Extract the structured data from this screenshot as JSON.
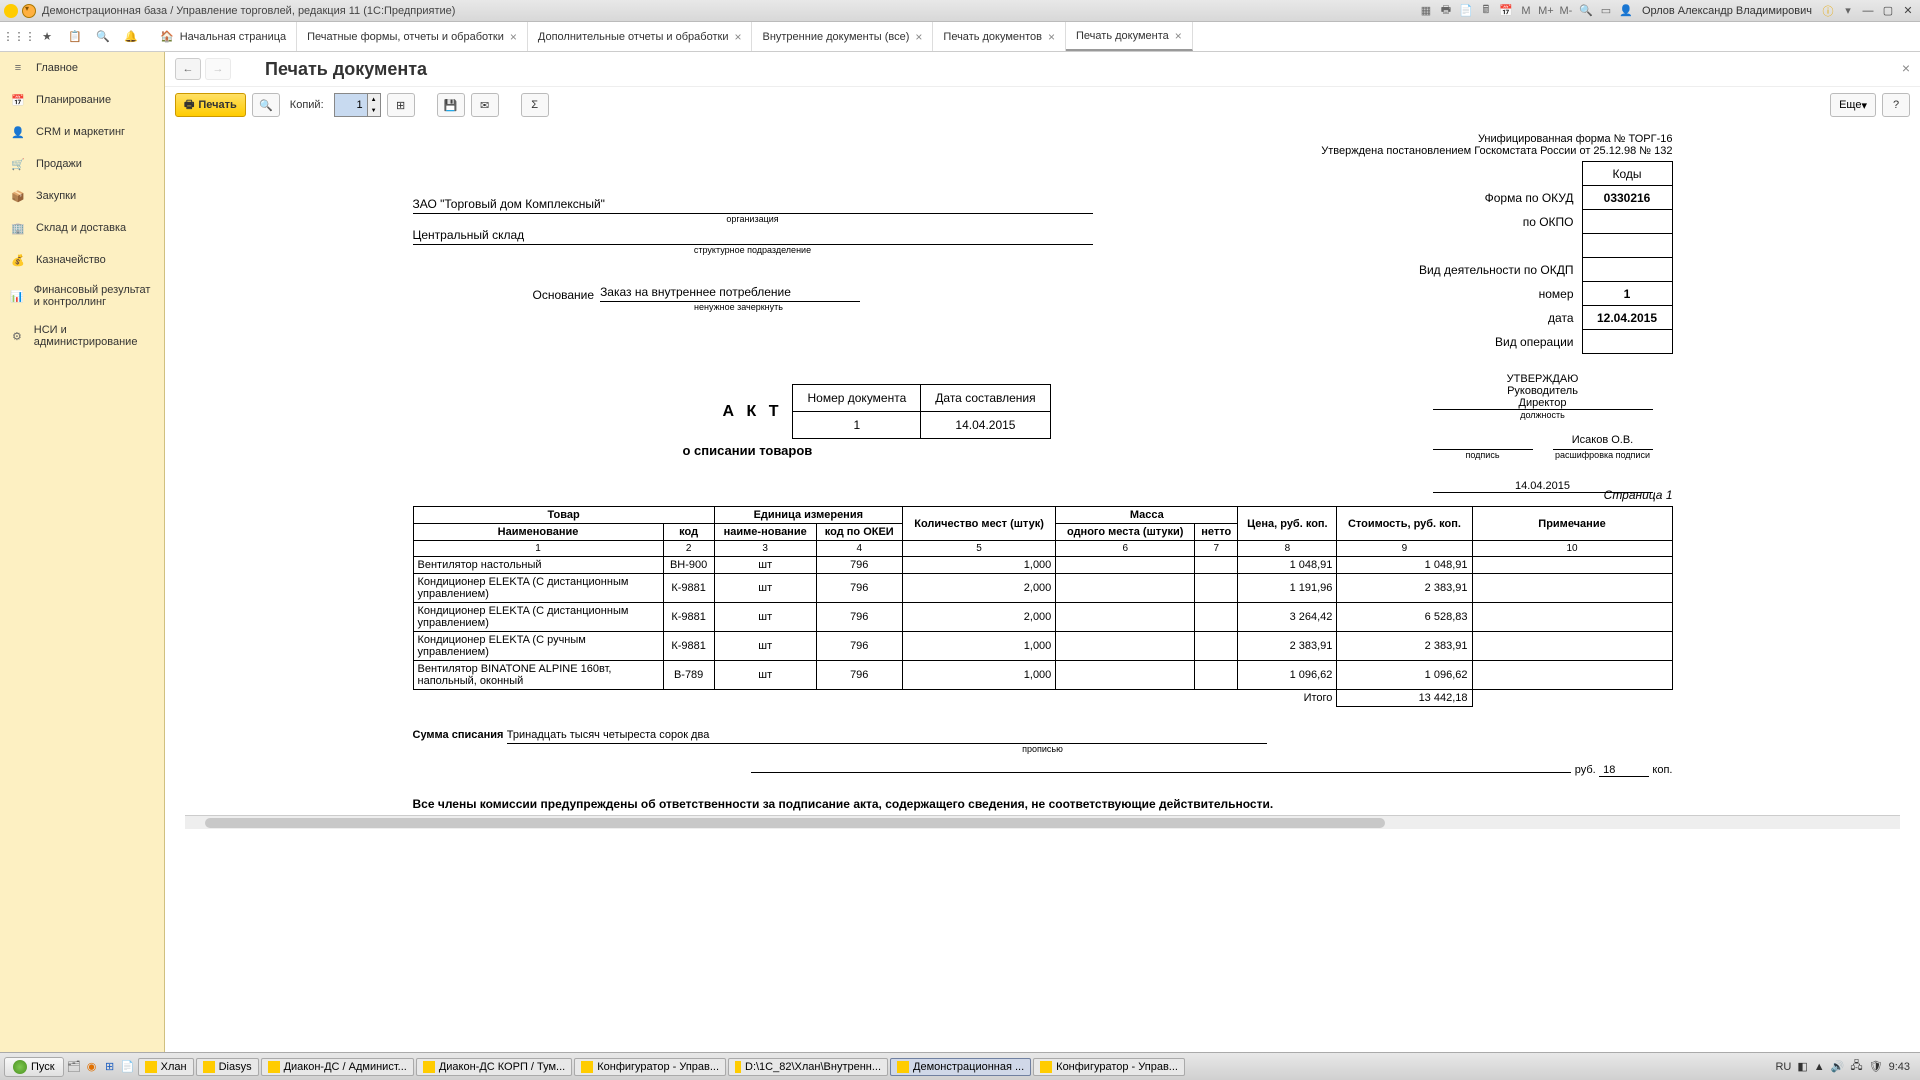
{
  "titlebar": {
    "title": "Демонстрационная база / Управление торговлей, редакция 11  (1С:Предприятие)",
    "user": "Орлов Александр Владимирович"
  },
  "tabs": [
    {
      "label": "Начальная страница",
      "closable": false,
      "home": true
    },
    {
      "label": "Печатные формы, отчеты и обработки",
      "closable": true
    },
    {
      "label": "Дополнительные отчеты и обработки",
      "closable": true
    },
    {
      "label": "Внутренние документы (все)",
      "closable": true
    },
    {
      "label": "Печать документов",
      "closable": true
    },
    {
      "label": "Печать документа",
      "closable": true,
      "active": true
    }
  ],
  "sidebar": [
    {
      "icon": "≡",
      "label": "Главное"
    },
    {
      "icon": "📅",
      "label": "Планирование"
    },
    {
      "icon": "👤",
      "label": "CRM и маркетинг"
    },
    {
      "icon": "🛒",
      "label": "Продажи"
    },
    {
      "icon": "📦",
      "label": "Закупки"
    },
    {
      "icon": "🏢",
      "label": "Склад и доставка"
    },
    {
      "icon": "💰",
      "label": "Казначейство"
    },
    {
      "icon": "📊",
      "label": "Финансовый результат и контроллинг"
    },
    {
      "icon": "⚙",
      "label": "НСИ и администрирование"
    }
  ],
  "content": {
    "title": "Печать документа",
    "print_btn": "Печать",
    "copies_label": "Копий:",
    "copies_value": "1",
    "more_btn": "Еще"
  },
  "doc": {
    "form_header1": "Унифицированная форма № ТОРГ-16",
    "form_header2": "Утверждена постановлением Госкомстата России от 25.12.98 № 132",
    "codes_header": "Коды",
    "okud_label": "Форма по ОКУД",
    "okud_value": "0330216",
    "okpo_label": "по ОКПО",
    "okdp_label": "Вид деятельности по ОКДП",
    "num_label": "номер",
    "num_value": "1",
    "date_label": "дата",
    "date_value": "12.04.2015",
    "oper_label": "Вид операции",
    "org": "ЗАО \"Торговый дом Комплексный\"",
    "org_sub": "организация",
    "dept": "Центральный склад",
    "dept_sub": "структурное подразделение",
    "basis_label": "Основание",
    "basis_value": "Заказ на внутреннее потребление",
    "basis_sub": "ненужное зачеркнуть",
    "doc_num_h": "Номер документа",
    "doc_date_h": "Дата составления",
    "doc_num": "1",
    "doc_date": "14.04.2015",
    "act": "А К Т",
    "act_sub": "о списании товаров",
    "approve": "УТВЕРЖДАЮ",
    "approve_role": "Руководитель",
    "approve_pos": "Директор",
    "approve_pos_sub": "должность",
    "approve_sign_sub": "подпись",
    "approve_name": "Исаков О.В.",
    "approve_name_sub": "расшифровка подписи",
    "approve_date": "14.04.2015",
    "page": "Страница 1",
    "th": {
      "tovar": "Товар",
      "unit": "Единица измерения",
      "qty": "Количество мест (штук)",
      "mass": "Масса",
      "price": "Цена, руб. коп.",
      "cost": "Стоимость, руб. коп.",
      "note": "Примечание",
      "name": "Наименование",
      "code": "код",
      "uname": "наиме-нование",
      "okei": "код по ОКЕИ",
      "one": "одного места (штуки)",
      "netto": "нетто"
    },
    "nums": [
      "1",
      "2",
      "3",
      "4",
      "5",
      "6",
      "7",
      "8",
      "9",
      "10"
    ],
    "rows": [
      {
        "name": "Вентилятор настольный",
        "code": "ВН-900",
        "unit": "шт",
        "okei": "796",
        "qty": "1,000",
        "price": "1 048,91",
        "cost": "1 048,91"
      },
      {
        "name": "Кондиционер ELEKTA (С дистанционным управлением)",
        "code": "К-9881",
        "unit": "шт",
        "okei": "796",
        "qty": "2,000",
        "price": "1 191,96",
        "cost": "2 383,91"
      },
      {
        "name": "Кондиционер ELEKTA (С дистанционным управлением)",
        "code": "К-9881",
        "unit": "шт",
        "okei": "796",
        "qty": "2,000",
        "price": "3 264,42",
        "cost": "6 528,83"
      },
      {
        "name": "Кондиционер ELEKTA (С ручным управлением)",
        "code": "К-9881",
        "unit": "шт",
        "okei": "796",
        "qty": "1,000",
        "price": "2 383,91",
        "cost": "2 383,91"
      },
      {
        "name": "Вентилятор BINATONE ALPINE 160вт, напольный, оконный",
        "code": "В-789",
        "unit": "шт",
        "okei": "796",
        "qty": "1,000",
        "price": "1 096,62",
        "cost": "1 096,62"
      }
    ],
    "total_label": "Итого",
    "total_value": "13 442,18",
    "sum_label": "Сумма списания",
    "sum_words": "Тринадцать тысяч четыреста сорок два",
    "sum_sub": "прописью",
    "rub_label": "руб.",
    "rub_value": "18",
    "kop_label": "коп.",
    "warn": "Все члены комиссии предупреждены об ответственности за подписание акта, содержащего сведения, не соответствующие действительности."
  },
  "taskbar": {
    "start": "Пуск",
    "tasks": [
      {
        "label": "Хлан"
      },
      {
        "label": "Diasys"
      },
      {
        "label": "Диакон-ДС / Админист..."
      },
      {
        "label": "Диакон-ДС КОРП / Тум..."
      },
      {
        "label": "Конфигуратор - Управ..."
      },
      {
        "label": "D:\\1C_82\\Хлан\\Внутренн..."
      },
      {
        "label": "Демонстрационная ...",
        "active": true
      },
      {
        "label": "Конфигуратор - Управ..."
      }
    ],
    "lang": "RU",
    "clock": "9:43"
  }
}
